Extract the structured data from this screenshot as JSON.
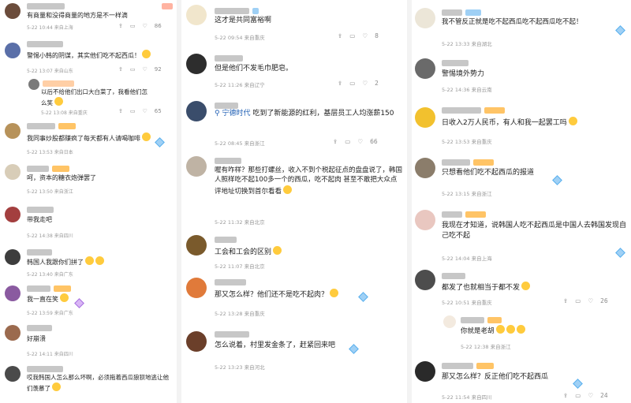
{
  "col1": [
    {
      "text": "有商量和没得商量的地方是不一样滴",
      "date": "5-22 10:44",
      "loc": "来自上海",
      "likes": "86",
      "badge": "作者"
    },
    {
      "text": "警惕小韩的阴谋，其实他们吃不起西瓜！",
      "date": "5-22 13:07",
      "loc": "来自山东",
      "likes": "92"
    },
    {
      "text": "以后不给他们出口大白菜了，我看他们怎么笑",
      "date": "5-22 13:08",
      "loc": "来自重庆",
      "likes": "65"
    },
    {
      "text": "我同事炒股都赚疯了每天都有人请喝咖啡",
      "date": "5-22 13:53",
      "loc": "来自日本",
      "likes": ""
    },
    {
      "text": "呵，资本的糖衣炮弹罢了",
      "date": "5-22 13:50",
      "loc": "来自浙江",
      "likes": ""
    },
    {
      "text": "带我走吧",
      "date": "5-22 14:38",
      "loc": "来自四川",
      "likes": ""
    },
    {
      "text": "韩国人我跟你们拼了",
      "date": "5-22 13:40",
      "loc": "来自广东",
      "likes": ""
    },
    {
      "text": "我一直在笑",
      "date": "5-22 13:59",
      "loc": "来自广东",
      "likes": ""
    },
    {
      "text": "好崩溃",
      "date": "5-22 14:11",
      "loc": "来自四川",
      "likes": ""
    },
    {
      "text": "哎我韩国人怎么那么坏啊，必须拖着西瓜狼狈地逃让他们羡慕了",
      "date": "",
      "loc": "",
      "likes": ""
    }
  ],
  "col2": [
    {
      "text": "这才是共同富裕啊",
      "date": "5-22 09:54",
      "loc": "来自重庆",
      "likes": "8"
    },
    {
      "text": "但是他们不发毛巾肥皂。",
      "date": "5-22 11:26",
      "loc": "来自辽宁",
      "likes": "2"
    },
    {
      "link": "宁德时代",
      "text": " 吃到了新能源的红利，基层员工人均涨薪150",
      "date": "5-22 08:45",
      "loc": "来自浙江",
      "likes": "66"
    },
    {
      "text": "喔有咋样？那些打螺丝，收入不到个税起征点的盘盘说了，韩国人照样吃不起100多一个的西瓜，吃不起肉 甚至不敢把大众点评地址切换到首尔看看",
      "date": "5-22 11:32",
      "loc": "来自北京",
      "likes": ""
    },
    {
      "text": "工会和工会的区别",
      "date": "5-22 11:07",
      "loc": "来自北京",
      "likes": ""
    },
    {
      "text": "那又怎么样？他们还不是吃不起肉？",
      "date": "5-22 13:28",
      "loc": "来自重庆",
      "likes": ""
    },
    {
      "text": "怎么说着，村里发金条了，赶紧回来吧",
      "date": "5-22 13:23",
      "loc": "来自河北",
      "likes": ""
    }
  ],
  "col3": [
    {
      "text": "我不管反正就是吃不起西瓜吃不起西瓜吃不起！",
      "date": "5-22 13:33",
      "loc": "来自湖北",
      "likes": ""
    },
    {
      "text": "警惕境外势力",
      "date": "5-22 14:36",
      "loc": "来自云南",
      "likes": ""
    },
    {
      "text": "日收入2万人民币，有人和我一起罢工吗",
      "date": "5-22 13:53",
      "loc": "来自重庆",
      "likes": ""
    },
    {
      "text": "只想看他们吃不起西瓜的报道",
      "date": "5-22 13:15",
      "loc": "来自浙江",
      "likes": ""
    },
    {
      "text": "我现在才知道，说韩国人吃不起西瓜是中国人去韩国发现自己吃不起",
      "date": "5-22 14:04",
      "loc": "来自上海",
      "likes": ""
    },
    {
      "text": "都发了也就相当于都不发",
      "date": "5-22 10:51",
      "loc": "来自重庆",
      "likes": "26"
    },
    {
      "text": "你就是老胡",
      "date": "5-22 12:38",
      "loc": "来自浙江",
      "likes": ""
    },
    {
      "text": "那又怎么样？反正他们吃不起西瓜",
      "date": "5-22 11:54",
      "loc": "来自四川",
      "likes": "24"
    }
  ],
  "icons": {
    "reply": "reply-icon",
    "comment": "comment-icon",
    "like": "like-icon"
  }
}
